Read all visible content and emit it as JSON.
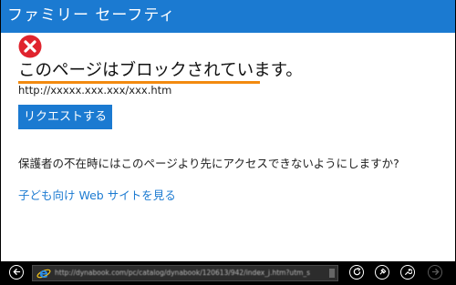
{
  "window": {
    "title": "ファミリー セーフティ"
  },
  "block_page": {
    "heading": "このページはブロックされています。",
    "url": "http://xxxxx.xxx.xxx/xxx.htm",
    "request_button": "リクエストする",
    "question": "保護者の不在時にはこのページより先にアクセスできないようにしますか?",
    "kids_link": "子ども向け Web サイトを見る"
  },
  "appbar": {
    "address": "http://dynabook.com/pc/catalog/dynabook/120613/942/index_j.htm?utm_s"
  },
  "colors": {
    "accent": "#1b7ad1",
    "error": "#e0242e",
    "underline": "#f28a10"
  }
}
